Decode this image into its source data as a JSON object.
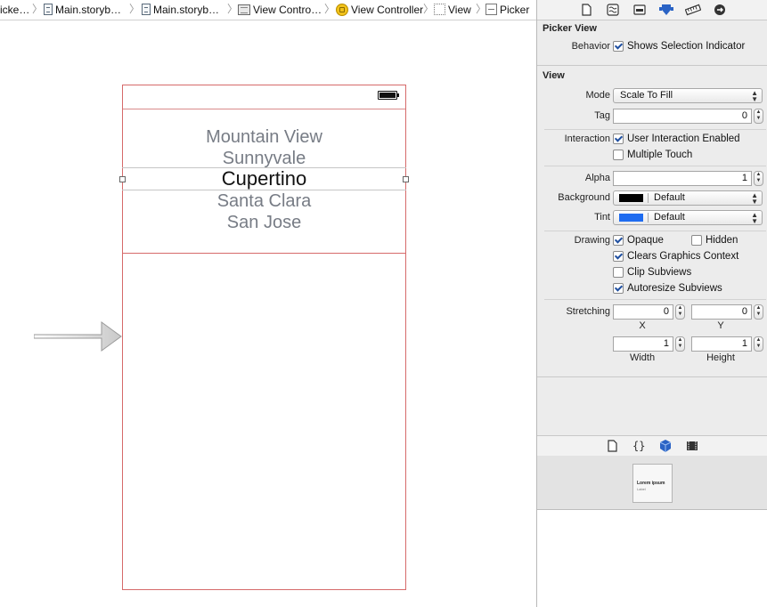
{
  "breadcrumb": {
    "items": [
      {
        "label": "icke…",
        "icon": "folder"
      },
      {
        "label": "Main.storyb…",
        "icon": "storyboard-file-icon"
      },
      {
        "label": "Main.storyb…",
        "icon": "storyboard-file-icon"
      },
      {
        "label": "View Contro…",
        "icon": "view-controller-scene-icon"
      },
      {
        "label": "View Controller",
        "icon": "view-controller-icon"
      },
      {
        "label": "View",
        "icon": "view-icon"
      },
      {
        "label": "Picker",
        "icon": "picker-icon"
      }
    ]
  },
  "canvas": {
    "picker_rows": [
      "Mountain View",
      "Sunnyvale",
      "Cupertino",
      "Santa Clara",
      "San Jose"
    ],
    "selected_index": 2
  },
  "inspector": {
    "tabs": [
      "file-inspector-icon",
      "quick-help-icon",
      "identity-inspector-icon",
      "attributes-inspector-icon",
      "size-inspector-icon",
      "connections-inspector-icon"
    ],
    "active_tab": "attributes-inspector-icon",
    "accent_color": "#2a63c5",
    "picker_view": {
      "title": "Picker View",
      "behavior_label": "Behavior",
      "shows_selection_indicator": {
        "label": "Shows Selection Indicator",
        "checked": true
      }
    },
    "view": {
      "title": "View",
      "mode_label": "Mode",
      "mode_value": "Scale To Fill",
      "tag_label": "Tag",
      "tag_value": "0",
      "interaction_label": "Interaction",
      "user_interaction": {
        "label": "User Interaction Enabled",
        "checked": true
      },
      "multiple_touch": {
        "label": "Multiple Touch",
        "checked": false
      },
      "alpha_label": "Alpha",
      "alpha_value": "1",
      "background_label": "Background",
      "background_value": "Default",
      "background_color": "#000000",
      "tint_label": "Tint",
      "tint_value": "Default",
      "tint_color": "#1f6cf0",
      "drawing_label": "Drawing",
      "opaque": {
        "label": "Opaque",
        "checked": true
      },
      "hidden": {
        "label": "Hidden",
        "checked": false
      },
      "clears_graphics": {
        "label": "Clears Graphics Context",
        "checked": true
      },
      "clip_subviews": {
        "label": "Clip Subviews",
        "checked": false
      },
      "autoresize": {
        "label": "Autoresize Subviews",
        "checked": true
      },
      "stretching_label": "Stretching",
      "stretch_x": "0",
      "stretch_y": "0",
      "stretch_width": "1",
      "stretch_height": "1",
      "x_label": "X",
      "y_label": "Y",
      "width_label": "Width",
      "height_label": "Height"
    }
  },
  "library": {
    "tabs": [
      "file-template-icon",
      "code-snippet-icon",
      "object-library-icon",
      "media-library-icon"
    ],
    "active_tab": "object-library-icon",
    "thumb_title": "Lorem ipsum",
    "thumb_subtitle": "Label"
  }
}
